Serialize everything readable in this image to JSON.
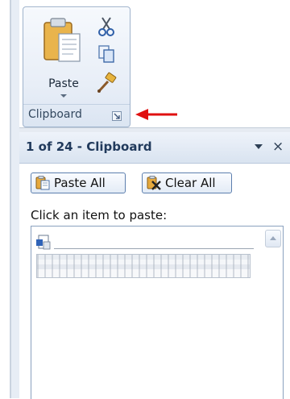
{
  "ribbon": {
    "paste_label": "Paste",
    "group_label": "Clipboard",
    "tools": {
      "cut": "scissors-icon",
      "copy": "copy-icon",
      "format_painter": "brush-icon"
    }
  },
  "pane": {
    "title": "1 of 24 - Clipboard",
    "close_glyph": "×",
    "paste_all_label": "Paste All",
    "clear_all_label": "Clear All",
    "hint": "Click an item to paste:"
  },
  "colors": {
    "accent_red": "#e01010",
    "border_blue": "#5d7fae"
  }
}
